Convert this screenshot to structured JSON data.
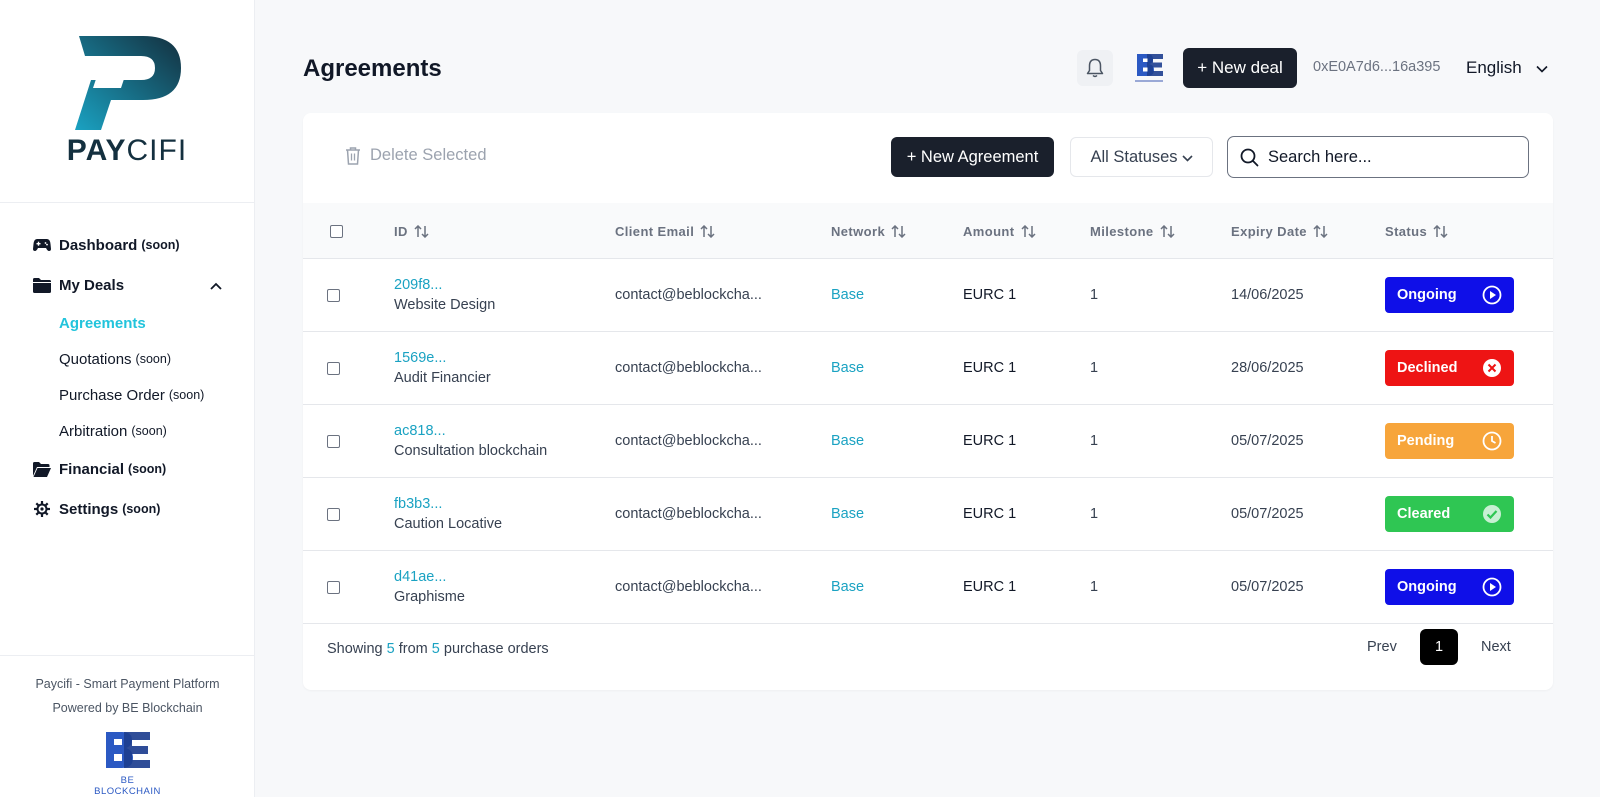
{
  "brand": {
    "name_part1": "PAY",
    "name_part2": "CIFI"
  },
  "sidebar": {
    "items": [
      {
        "label": "Dashboard",
        "soon": "(soon)"
      },
      {
        "label": "My Deals"
      },
      {
        "label": "Financial",
        "soon": "(soon)"
      },
      {
        "label": "Settings",
        "soon": "(soon)"
      }
    ],
    "sub_items": [
      {
        "label": "Agreements"
      },
      {
        "label": "Quotations",
        "soon": "(soon)"
      },
      {
        "label": "Purchase Order",
        "soon": "(soon)"
      },
      {
        "label": "Arbitration",
        "soon": "(soon)"
      }
    ],
    "footer": {
      "line1": "Paycifi - Smart Payment Platform",
      "line2": "Powered by BE Blockchain",
      "logo_caption": "BE BLOCKCHAIN"
    }
  },
  "header": {
    "title": "Agreements",
    "new_deal_label": "+ New deal",
    "wallet": "0xE0A7d6...16a395",
    "language": "English"
  },
  "toolbar": {
    "delete_label": "Delete Selected",
    "new_agreement_label": "+ New Agreement",
    "status_filter": "All Statuses",
    "search_placeholder": "Search here..."
  },
  "table": {
    "columns": [
      "ID",
      "Client Email",
      "Network",
      "Amount",
      "Milestone",
      "Expiry Date",
      "Status"
    ],
    "rows": [
      {
        "id": "209f8...",
        "title": "Website Design",
        "email": "contact@beblockcha...",
        "network": "Base",
        "amount": "EURC 1",
        "milestone": "1",
        "expiry": "14/06/2025",
        "status": "Ongoing"
      },
      {
        "id": "1569e...",
        "title": "Audit Financier",
        "email": "contact@beblockcha...",
        "network": "Base",
        "amount": "EURC 1",
        "milestone": "1",
        "expiry": "28/06/2025",
        "status": "Declined"
      },
      {
        "id": "ac818...",
        "title": "Consultation blockchain",
        "email": "contact@beblockcha...",
        "network": "Base",
        "amount": "EURC 1",
        "milestone": "1",
        "expiry": "05/07/2025",
        "status": "Pending"
      },
      {
        "id": "fb3b3...",
        "title": "Caution Locative",
        "email": "contact@beblockcha...",
        "network": "Base",
        "amount": "EURC 1",
        "milestone": "1",
        "expiry": "05/07/2025",
        "status": "Cleared"
      },
      {
        "id": "d41ae...",
        "title": "Graphisme",
        "email": "contact@beblockcha...",
        "network": "Base",
        "amount": "EURC 1",
        "milestone": "1",
        "expiry": "05/07/2025",
        "status": "Ongoing"
      }
    ]
  },
  "status_colors": {
    "Ongoing": "#0f0fe8",
    "Declined": "#ee1414",
    "Pending": "#f7a53b",
    "Cleared": "#2fc653"
  },
  "status_icons": {
    "Ongoing": "play-circle-icon",
    "Declined": "x-circle-icon",
    "Pending": "clock-icon",
    "Cleared": "check-circle-icon"
  },
  "pagination": {
    "showing_prefix": "Showing",
    "showing_count": "5",
    "showing_from": "from",
    "showing_total": "5",
    "showing_suffix": "purchase orders",
    "prev": "Prev",
    "page": "1",
    "next": "Next"
  }
}
